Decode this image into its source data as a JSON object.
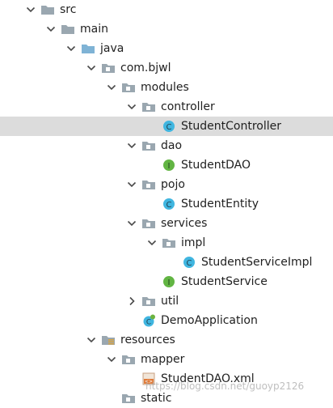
{
  "tree": [
    {
      "label": "src",
      "depth": 0,
      "arrow": "down",
      "icon": "folder-icon",
      "selected": false
    },
    {
      "label": "main",
      "depth": 1,
      "arrow": "down",
      "icon": "folder-icon",
      "selected": false
    },
    {
      "label": "java",
      "depth": 2,
      "arrow": "down",
      "icon": "source-folder-icon",
      "selected": false
    },
    {
      "label": "com.bjwl",
      "depth": 3,
      "arrow": "down",
      "icon": "package-icon",
      "selected": false
    },
    {
      "label": "modules",
      "depth": 4,
      "arrow": "down",
      "icon": "package-icon",
      "selected": false
    },
    {
      "label": "controller",
      "depth": 5,
      "arrow": "down",
      "icon": "package-icon",
      "selected": false
    },
    {
      "label": "StudentController",
      "depth": 6,
      "arrow": "none",
      "icon": "class-icon",
      "selected": true
    },
    {
      "label": "dao",
      "depth": 5,
      "arrow": "down",
      "icon": "package-icon",
      "selected": false
    },
    {
      "label": "StudentDAO",
      "depth": 6,
      "arrow": "none",
      "icon": "interface-icon",
      "selected": false
    },
    {
      "label": "pojo",
      "depth": 5,
      "arrow": "down",
      "icon": "package-icon",
      "selected": false
    },
    {
      "label": "StudentEntity",
      "depth": 6,
      "arrow": "none",
      "icon": "class-icon",
      "selected": false
    },
    {
      "label": "services",
      "depth": 5,
      "arrow": "down",
      "icon": "package-icon",
      "selected": false
    },
    {
      "label": "impl",
      "depth": 6,
      "arrow": "down",
      "icon": "package-icon",
      "selected": false
    },
    {
      "label": "StudentServiceImpl",
      "depth": 7,
      "arrow": "none",
      "icon": "class-icon",
      "selected": false
    },
    {
      "label": "StudentService",
      "depth": 6,
      "arrow": "none",
      "icon": "interface-icon",
      "selected": false
    },
    {
      "label": "util",
      "depth": 5,
      "arrow": "right",
      "icon": "package-icon",
      "selected": false
    },
    {
      "label": "DemoApplication",
      "depth": 5,
      "arrow": "none",
      "icon": "spring-boot-class-icon",
      "selected": false
    },
    {
      "label": "resources",
      "depth": 3,
      "arrow": "down",
      "icon": "resources-folder-icon",
      "selected": false
    },
    {
      "label": "mapper",
      "depth": 4,
      "arrow": "down",
      "icon": "package-icon",
      "selected": false
    },
    {
      "label": "StudentDAO.xml",
      "depth": 5,
      "arrow": "none",
      "icon": "xml-file-icon",
      "selected": false
    },
    {
      "label": "static",
      "depth": 4,
      "arrow": "none",
      "icon": "package-icon",
      "selected": false
    }
  ],
  "watermark": "https://blog.csdn.net/guoyp2126",
  "colors": {
    "selection": "#dcdcdc",
    "folder": "#9aa7b0",
    "source_folder": "#7fb3d5",
    "class": "#40b6e0",
    "interface": "#62b543",
    "xml": "#e07b39"
  }
}
